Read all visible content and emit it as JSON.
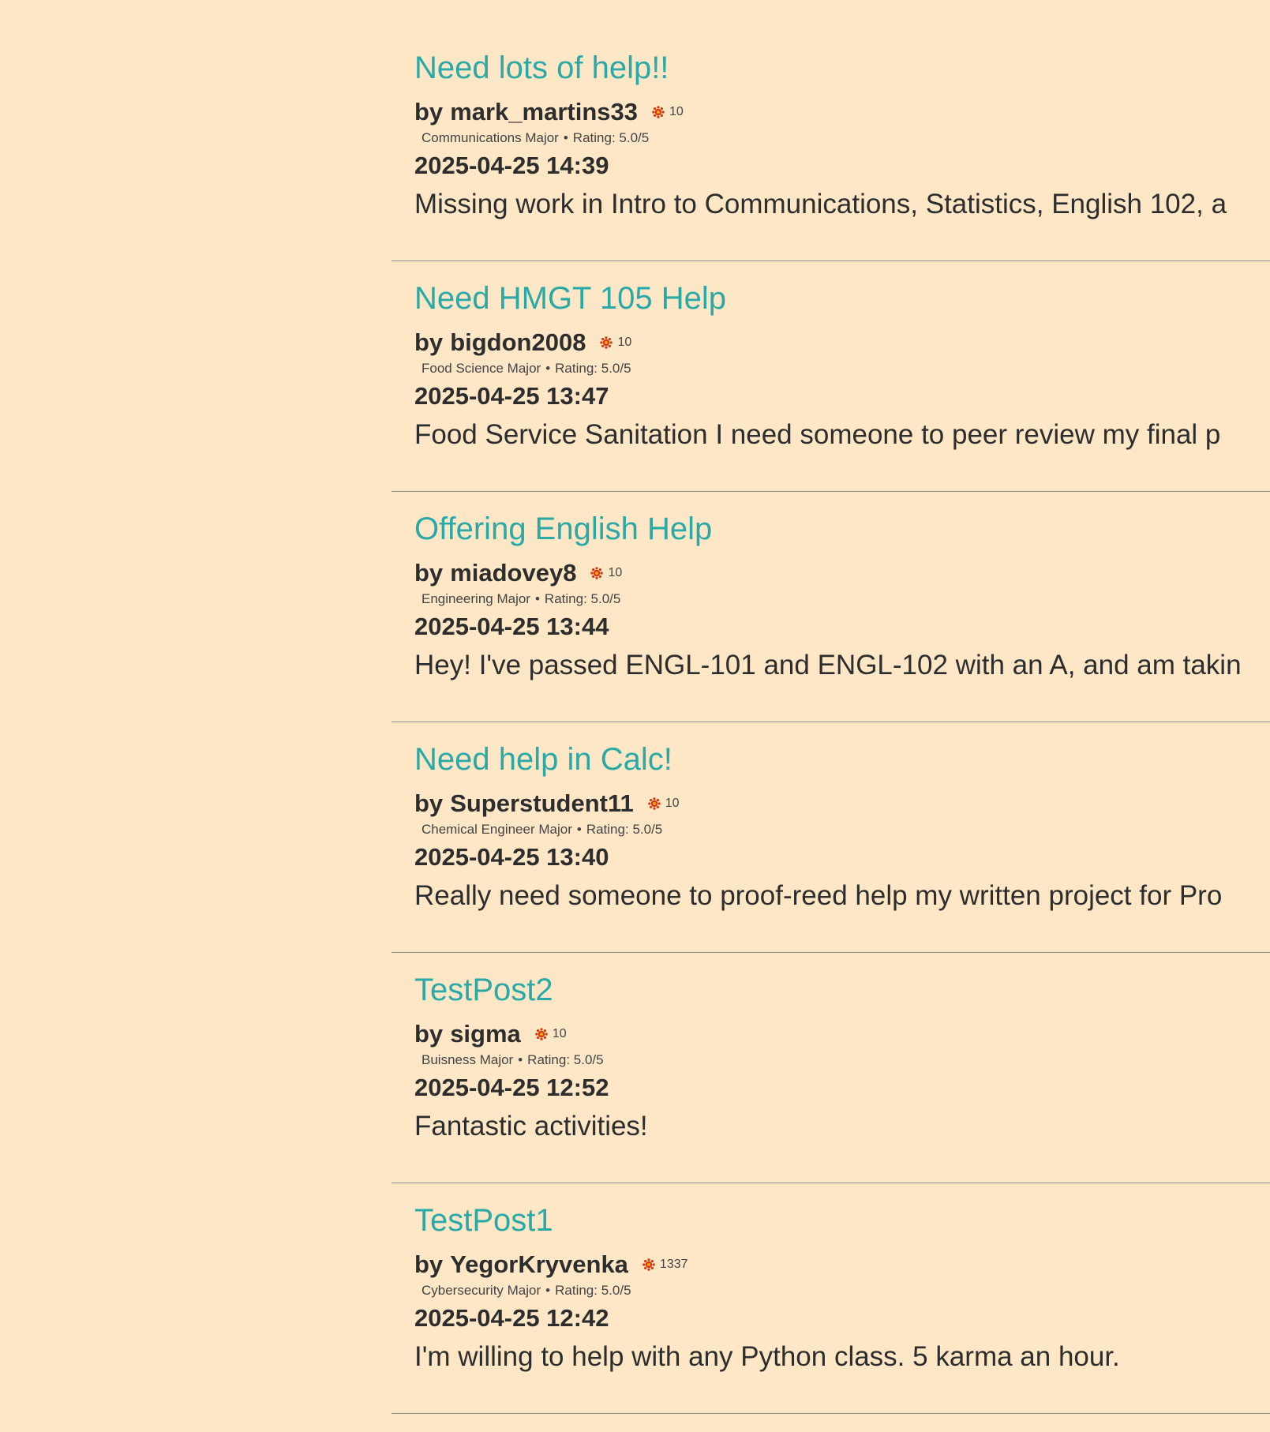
{
  "theme": {
    "background": "#fde7c6",
    "title_color": "#2aa9a7",
    "text_color": "#2d2d2d",
    "karma_icon_color": "#d9380d"
  },
  "labels": {
    "by_prefix": "by",
    "rating_prefix": "Rating:",
    "meta_separator": "•",
    "karma_icon": "sun-badge-icon"
  },
  "posts": [
    {
      "title": "Need lots of help!!",
      "author": "mark_martins33",
      "karma": "10",
      "major": "Communications Major",
      "rating": "5.0/5",
      "timestamp": "2025-04-25 14:39",
      "body": "Missing work in Intro to Communications, Statistics, English 102, a"
    },
    {
      "title": "Need HMGT 105 Help",
      "author": "bigdon2008",
      "karma": "10",
      "major": "Food Science Major",
      "rating": "5.0/5",
      "timestamp": "2025-04-25 13:47",
      "body": "Food Service Sanitation I need someone to peer review my final p"
    },
    {
      "title": "Offering English Help",
      "author": "miadovey8",
      "karma": "10",
      "major": "Engineering Major",
      "rating": "5.0/5",
      "timestamp": "2025-04-25 13:44",
      "body": "Hey! I've passed ENGL-101 and ENGL-102 with an A, and am takin"
    },
    {
      "title": "Need help in Calc!",
      "author": "Superstudent11",
      "karma": "10",
      "major": "Chemical Engineer Major",
      "rating": "5.0/5",
      "timestamp": "2025-04-25 13:40",
      "body": "Really need someone to proof-reed help my written project for Pro"
    },
    {
      "title": "TestPost2",
      "author": "sigma",
      "karma": "10",
      "major": "Buisness Major",
      "rating": "5.0/5",
      "timestamp": "2025-04-25 12:52",
      "body": "Fantastic activities!"
    },
    {
      "title": "TestPost1",
      "author": "YegorKryvenka",
      "karma": "1337",
      "major": "Cybersecurity Major",
      "rating": "5.0/5",
      "timestamp": "2025-04-25 12:42",
      "body": "I'm willing to help with any Python class. 5 karma an hour."
    }
  ]
}
